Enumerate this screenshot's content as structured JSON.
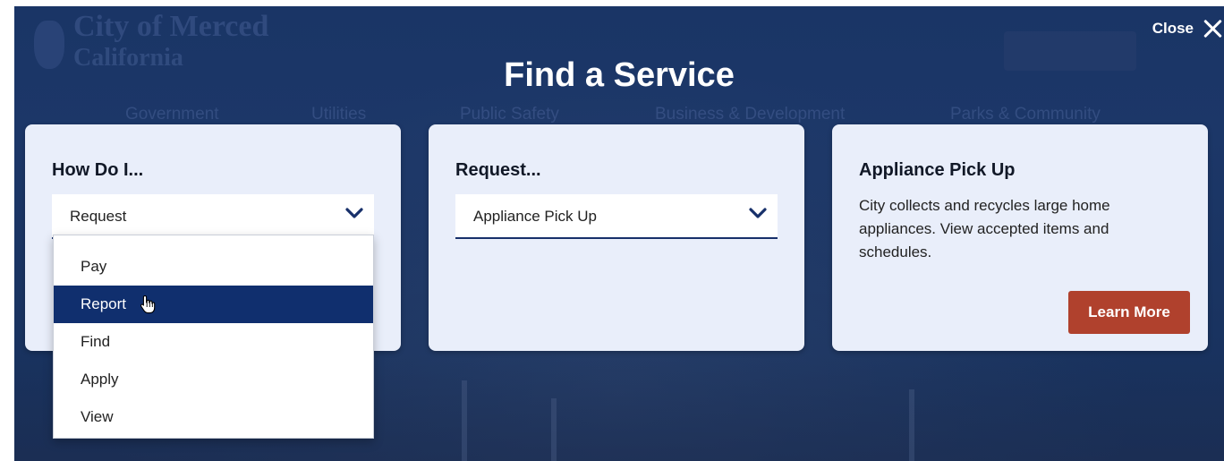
{
  "background": {
    "logo_line1": "City of Merced",
    "logo_line2": "California",
    "nav": [
      "Government",
      "Utilities",
      "Public Safety",
      "Business & Development",
      "Parks & Community"
    ]
  },
  "close": {
    "label": "Close",
    "icon": "close-x-icon"
  },
  "modal_title": "Find a Service",
  "cards": {
    "how_do_i": {
      "heading": "How Do I...",
      "selected": "Request",
      "options": [
        "Pay",
        "Report",
        "Find",
        "Apply",
        "View"
      ],
      "highlighted_option": "Report"
    },
    "request": {
      "heading": "Request...",
      "selected": "Appliance Pick Up"
    },
    "result": {
      "heading": "Appliance Pick Up",
      "description": "City collects and recycles large home appliances. View accepted items and schedules.",
      "button_label": "Learn More"
    }
  },
  "colors": {
    "overlay": "#1a3566",
    "card_bg": "#e9eefa",
    "accent_navy": "#102f6e",
    "button": "#b0412d"
  }
}
